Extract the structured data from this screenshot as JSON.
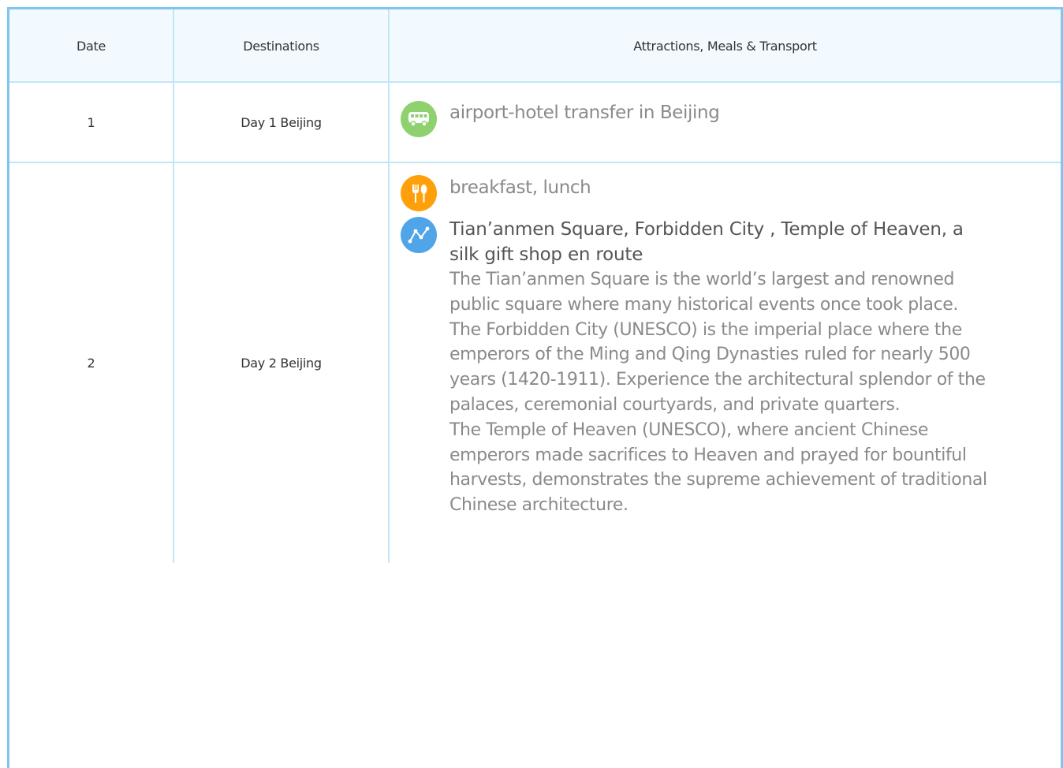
{
  "table": {
    "headers": {
      "date": "Date",
      "destinations": "Destinations",
      "attractions": "Attractions, Meals & Transport"
    },
    "rows": [
      {
        "date": "1",
        "destination": "Day 1 Beijing",
        "items": [
          {
            "icon": "bus-icon",
            "text": "airport-hotel transfer in Beijing"
          }
        ]
      },
      {
        "date": "2",
        "destination": "Day 2 Beijing",
        "items": [
          {
            "icon": "fork-spoon-icon",
            "text": "breakfast, lunch"
          },
          {
            "icon": "route-icon",
            "title": "Tian’anmen Square, Forbidden City , Temple of Heaven, a silk gift shop en route",
            "description": "The Tian’anmen Square is the world’s largest and renowned public square where many historical events once took place.\nThe Forbidden City (UNESCO) is the imperial place where the emperors of the Ming and Qing Dynasties ruled for nearly 500 years (1420-1911). Experience the architectural splendor of the palaces, ceremonial courtyards, and private quarters.\nThe Temple of Heaven (UNESCO), where ancient Chinese emperors made sacrifices to Heaven and prayed for bountiful harvests, demonstrates the supreme achievement of traditional Chinese architecture."
          }
        ]
      }
    ]
  },
  "colors": {
    "border": "#7dc6ef",
    "grid": "#c2e6f7",
    "header_bg": "#f2faff",
    "transport_icon": "#8fd16f",
    "meal_icon": "#ffa00b",
    "attraction_icon": "#4fa5e8"
  }
}
